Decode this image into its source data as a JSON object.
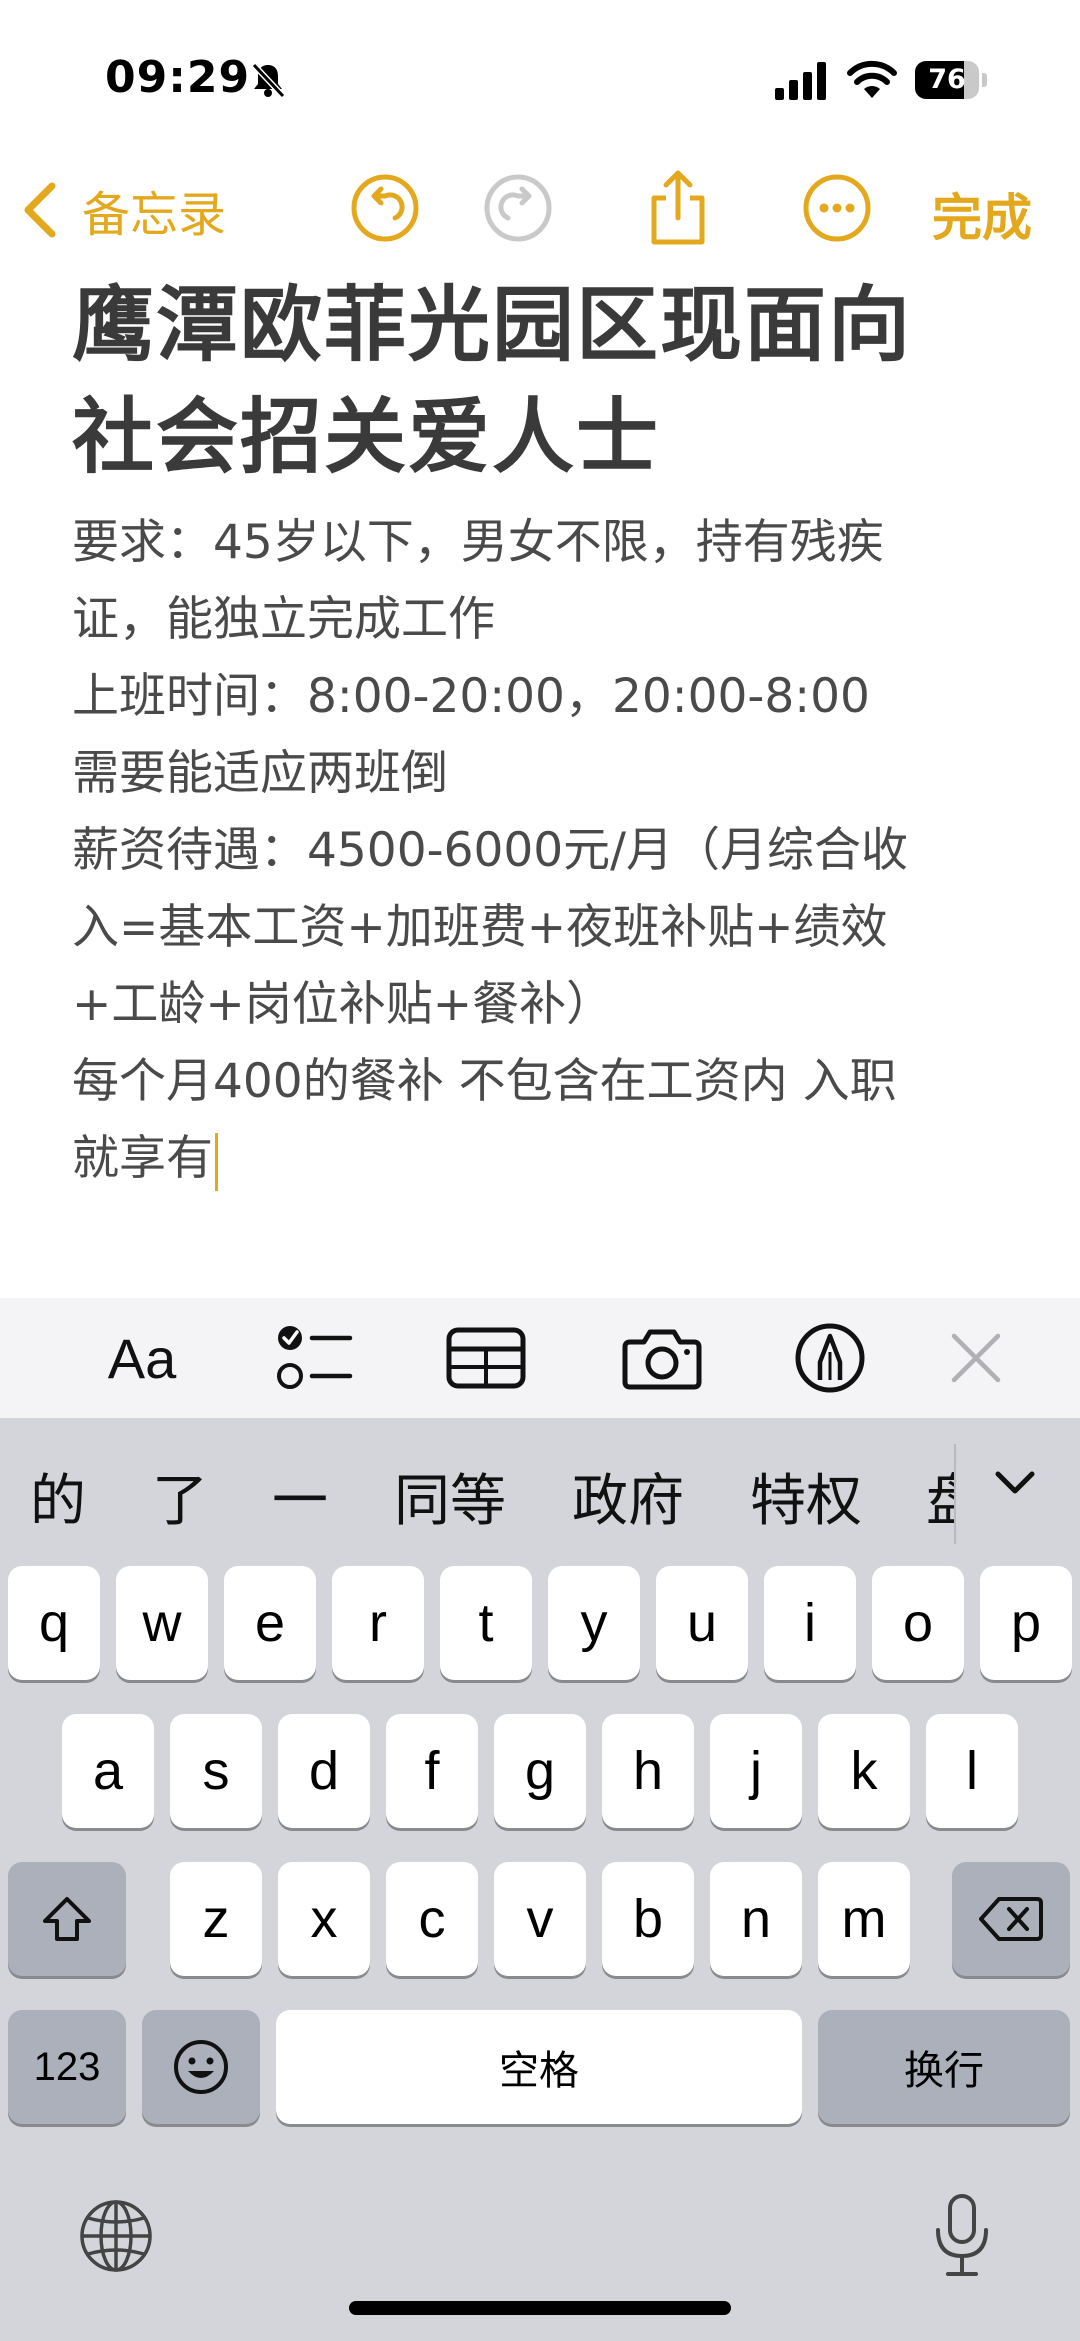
{
  "status_bar": {
    "time": "09:29",
    "battery": "76",
    "battery_level": 0.76
  },
  "toolbar": {
    "back_label": "备忘录",
    "done_label": "完成"
  },
  "note": {
    "title_lines": [
      "鹰潭欧菲光园区现面向",
      "社会招关爱人士"
    ],
    "body_lines": [
      "要求：45岁以下，男女不限，持有残疾",
      "证，能独立完成工作",
      "上班时间：8:00-20:00，20:00-8:00",
      "需要能适应两班倒",
      "薪资待遇：4500-6000元/月（月综合收",
      "入=基本工资+加班费+夜班补贴+绩效",
      "+工龄+岗位补贴+餐补）",
      "每个月400的餐补 不包含在工资内 入职",
      "就享有"
    ]
  },
  "format_bar": {
    "text_style_label": "Aa"
  },
  "keyboard": {
    "candidates": [
      "的",
      "了",
      "一",
      "同等",
      "政府",
      "特权",
      "盘"
    ],
    "row1": [
      "q",
      "w",
      "e",
      "r",
      "t",
      "y",
      "u",
      "i",
      "o",
      "p"
    ],
    "row2": [
      "a",
      "s",
      "d",
      "f",
      "g",
      "h",
      "j",
      "k",
      "l"
    ],
    "row3": [
      "z",
      "x",
      "c",
      "v",
      "b",
      "n",
      "m"
    ],
    "numbers_label": "123",
    "space_label": "空格",
    "return_label": "换行"
  },
  "colors": {
    "accent": "#e3a81c",
    "keyboard_bg": "#d3d5db",
    "key_bg": "#ffffff",
    "key_dark_bg": "#abb0bb"
  }
}
